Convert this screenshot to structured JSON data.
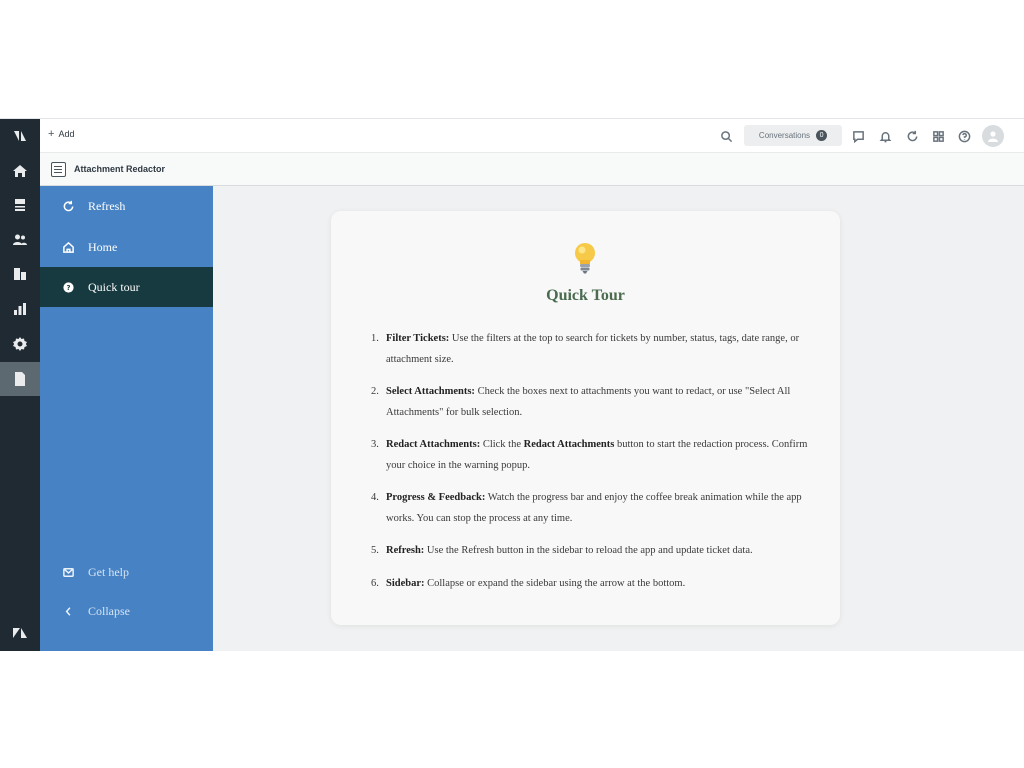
{
  "topbar": {
    "add_label": "Add",
    "conversations_label": "Conversations",
    "conversations_count": "0"
  },
  "app": {
    "title": "Attachment Redactor"
  },
  "sidebar": {
    "items": [
      {
        "label": "Refresh",
        "icon": "refresh-icon"
      },
      {
        "label": "Home",
        "icon": "home-icon"
      },
      {
        "label": "Quick tour",
        "icon": "help-circle-icon"
      },
      {
        "label": "Get help",
        "icon": "mail-icon"
      },
      {
        "label": "Collapse",
        "icon": "chevron-left-icon"
      }
    ]
  },
  "tour": {
    "title": "Quick Tour",
    "steps": [
      {
        "n": "1.",
        "parts": [
          {
            "b": "Filter Tickets:"
          },
          {
            "t": " Use the filters at the top to search for tickets by number, status, tags, date range, or attachment size."
          }
        ]
      },
      {
        "n": "2.",
        "parts": [
          {
            "b": "Select Attachments:"
          },
          {
            "t": " Check the boxes next to attachments you want to redact, or use \"Select All Attachments\" for bulk selection."
          }
        ]
      },
      {
        "n": "3.",
        "parts": [
          {
            "b": "Redact Attachments:"
          },
          {
            "t": " Click the "
          },
          {
            "b": "Redact Attachments"
          },
          {
            "t": " button to start the redaction process. Confirm your choice in the warning popup."
          }
        ]
      },
      {
        "n": "4.",
        "parts": [
          {
            "b": "Progress & Feedback:"
          },
          {
            "t": " Watch the progress bar and enjoy the coffee break animation while the app works. You can stop the process at any time."
          }
        ]
      },
      {
        "n": "5.",
        "parts": [
          {
            "b": "Refresh:"
          },
          {
            "t": " Use the Refresh button in the sidebar to reload the app and update ticket data."
          }
        ]
      },
      {
        "n": "6.",
        "parts": [
          {
            "b": "Sidebar:"
          },
          {
            "t": " Collapse or expand the sidebar using the arrow at the bottom."
          }
        ]
      }
    ]
  },
  "colors": {
    "sidebar_bg": "#4682c4",
    "sidebar_active_bg": "#173a40",
    "product_nav_bg": "#1f2a33",
    "tour_title": "#4a6b4f"
  }
}
